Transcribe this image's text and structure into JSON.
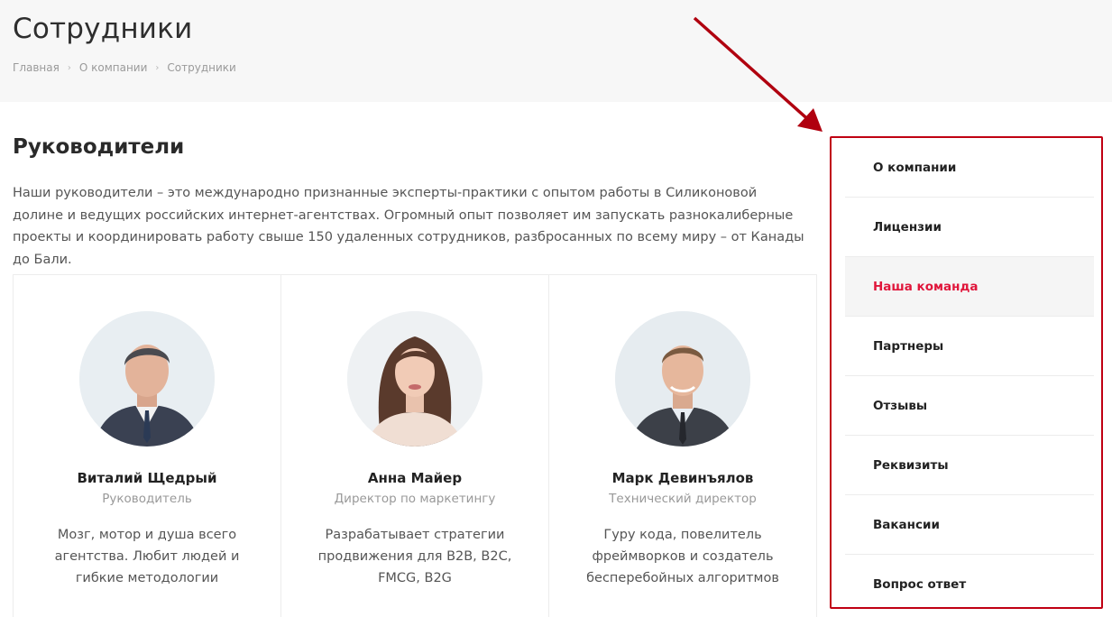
{
  "header": {
    "title": "Сотрудники",
    "breadcrumbs": [
      "Главная",
      "О компании",
      "Сотрудники"
    ]
  },
  "section": {
    "title": "Руководители",
    "intro": "Наши руководители – это международно признанные эксперты-практики с опытом работы в Силиконовой долине и ведущих российских интернет-агентствах. Огромный опыт позволяет им запускать разнокалиберные проекты и координировать работу свыше 150 удаленных сотрудников, разбросанных по всему миру – от Канады до Бали."
  },
  "team": [
    {
      "name": "Виталий Щедрый",
      "role": "Руководитель",
      "description": "Мозг, мотор и душа всего агентства. Любит людей и гибкие методологии"
    },
    {
      "name": "Анна Майер",
      "role": "Директор по маркетингу",
      "description": "Разрабатывает стратегии продвижения для B2B, B2C, FMCG, B2G"
    },
    {
      "name": "Марк Девинъялов",
      "role": "Технический директор",
      "description": "Гуру кода, повелитель фреймворков и создатель бесперебойных алгоритмов"
    }
  ],
  "side_menu": {
    "items": [
      "О компании",
      "Лицензии",
      "Наша команда",
      "Партнеры",
      "Отзывы",
      "Реквизиты",
      "Вакансии",
      "Вопрос ответ"
    ],
    "active": "Наша команда"
  },
  "colors": {
    "accent": "#e0163b",
    "highlight_border": "#c00013",
    "header_bg": "#f7f7f7"
  }
}
